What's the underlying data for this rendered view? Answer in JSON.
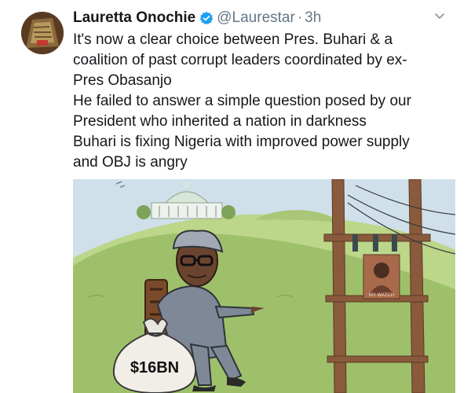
{
  "tweet": {
    "author_name": "Lauretta Onochie",
    "handle": "@Laurestar",
    "separator": "·",
    "time": "3h",
    "text_lines": [
      "It's now a clear choice between Pres. Buhari & a",
      "coalition of past corrupt leaders coordinated by ex-",
      "Pres Obasanjo",
      "He failed to answer a simple question posed by our",
      "President who inherited a nation in darkness",
      "Buhari is fixing Nigeria with improved power supply",
      "and OBJ is angry"
    ],
    "image": {
      "money_bag_label": "$16BN",
      "poster_caption": "MY WATCH"
    }
  },
  "icons": {
    "verified": "verified-badge-icon",
    "caret": "chevron-down-icon"
  },
  "colors": {
    "text": "#14171a",
    "secondary": "#657786",
    "verified": "#1da1f2",
    "hill_green": "#9ec06a"
  }
}
